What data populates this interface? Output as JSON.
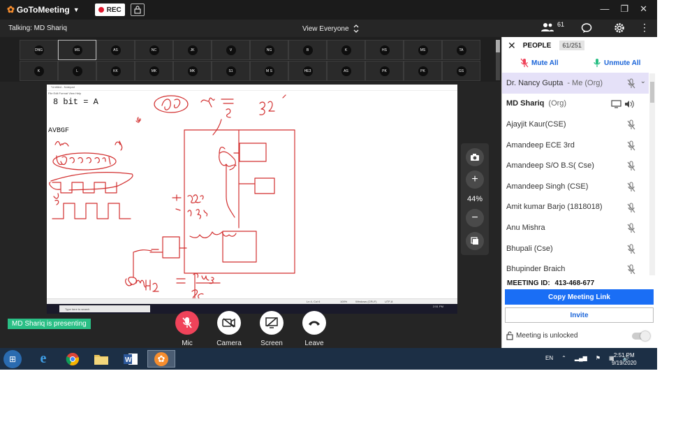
{
  "app": {
    "name": "GoToMeeting",
    "rec_label": "REC"
  },
  "talkbar": {
    "talking": "Talking: MD Shariq",
    "view": "View Everyone"
  },
  "header": {
    "people_count": "61"
  },
  "thumbnails": {
    "row1": [
      "DNG",
      "MS",
      "AS",
      "NC",
      "JK",
      "V",
      "NG",
      "B",
      "K",
      "HS",
      "MS",
      "TA"
    ],
    "row2": [
      "K",
      "L",
      "KK",
      "MK",
      "MK",
      "S1",
      "M S",
      "HE3",
      "AS",
      "PK",
      "PK",
      "GS"
    ]
  },
  "shared_screen": {
    "title": "*Untitled - Notepad",
    "menu": "File  Edit  Format  View  Help",
    "line1": "8 bit = A",
    "line2": "AVBGF",
    "status_pos": "Ln 4, Col 6",
    "status_zoom": "100%",
    "status_eol": "Windows (CRLF)",
    "status_enc": "UTF-8",
    "search_placeholder": "Type here to search",
    "clock": "2:51 PM"
  },
  "zoom": {
    "level": "44%"
  },
  "presenting": "MD Shariq is presenting",
  "controls": {
    "mic": "Mic",
    "camera": "Camera",
    "screen": "Screen",
    "leave": "Leave"
  },
  "panel": {
    "title": "PEOPLE",
    "count": "61/251",
    "mute_all": "Mute All",
    "unmute_all": "Unmute All",
    "participants": [
      {
        "name": "Dr. Nancy Gupta",
        "role": "- Me (Org)"
      },
      {
        "name": "MD Shariq",
        "role": "(Org)"
      },
      {
        "name": "Ajayjit Kaur(CSE)",
        "role": ""
      },
      {
        "name": "Amandeep ECE 3rd",
        "role": ""
      },
      {
        "name": "Amandeep S/O B.S( Cse)",
        "role": ""
      },
      {
        "name": "Amandeep Singh (CSE)",
        "role": ""
      },
      {
        "name": "Amit kumar Barjo (1818018)",
        "role": ""
      },
      {
        "name": "Anu Mishra",
        "role": ""
      },
      {
        "name": "Bhupali (Cse)",
        "role": ""
      },
      {
        "name": "Bhupinder Braich",
        "role": ""
      }
    ],
    "meeting_id_label": "MEETING ID:",
    "meeting_id": "413-468-677",
    "copy_link": "Copy Meeting Link",
    "invite": "Invite",
    "lock_status": "Meeting is unlocked"
  },
  "taskbar": {
    "lang": "EN",
    "time": "2:51 PM",
    "date": "9/19/2020"
  },
  "colors": {
    "rec_red": "#e0182d",
    "accent_blue": "#1a6ef5",
    "presenting_green": "#2abf85",
    "mic_red": "#f0435a",
    "ink_red": "#d22f2f"
  }
}
